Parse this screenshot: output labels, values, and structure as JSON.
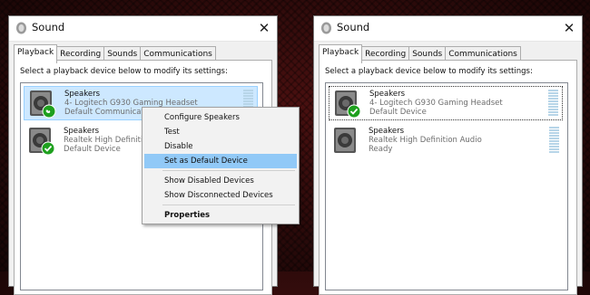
{
  "left_window": {
    "title": "Sound",
    "close_glyph": "✕",
    "tabs": [
      {
        "label": "Playback",
        "active": true
      },
      {
        "label": "Recording"
      },
      {
        "label": "Sounds"
      },
      {
        "label": "Communications"
      }
    ],
    "instruction": "Select a playback device below to modify its settings:",
    "devices": [
      {
        "name": "Speakers",
        "description": "4- Logitech G930 Gaming Headset",
        "status": "Default Communications Device",
        "badge": "phone-check-icon",
        "selected": true
      },
      {
        "name": "Speakers",
        "description": "Realtek High Definition Audio",
        "status": "Default Device",
        "badge": "check-icon",
        "selected": false
      }
    ],
    "context_menu": {
      "items": [
        {
          "label": "Configure Speakers"
        },
        {
          "label": "Test"
        },
        {
          "label": "Disable"
        },
        {
          "label": "Set as Default Device",
          "highlighted": true
        },
        {
          "label": "Show Disabled Devices"
        },
        {
          "label": "Show Disconnected Devices"
        },
        {
          "label": "Properties",
          "bold": true
        }
      ]
    }
  },
  "right_window": {
    "title": "Sound",
    "close_glyph": "✕",
    "tabs": [
      {
        "label": "Playback",
        "active": true
      },
      {
        "label": "Recording"
      },
      {
        "label": "Sounds"
      },
      {
        "label": "Communications"
      }
    ],
    "instruction": "Select a playback device below to modify its settings:",
    "devices": [
      {
        "name": "Speakers",
        "description": "4- Logitech G930 Gaming Headset",
        "status": "Default Device",
        "badge": "check-icon",
        "selected": false
      },
      {
        "name": "Speakers",
        "description": "Realtek High Definition Audio",
        "status": "Ready",
        "badge": "",
        "selected": false
      }
    ]
  },
  "colors": {
    "check_green": "#1ea01e",
    "selection": "#cde8ff",
    "menu_highlight": "#91c9f7"
  }
}
